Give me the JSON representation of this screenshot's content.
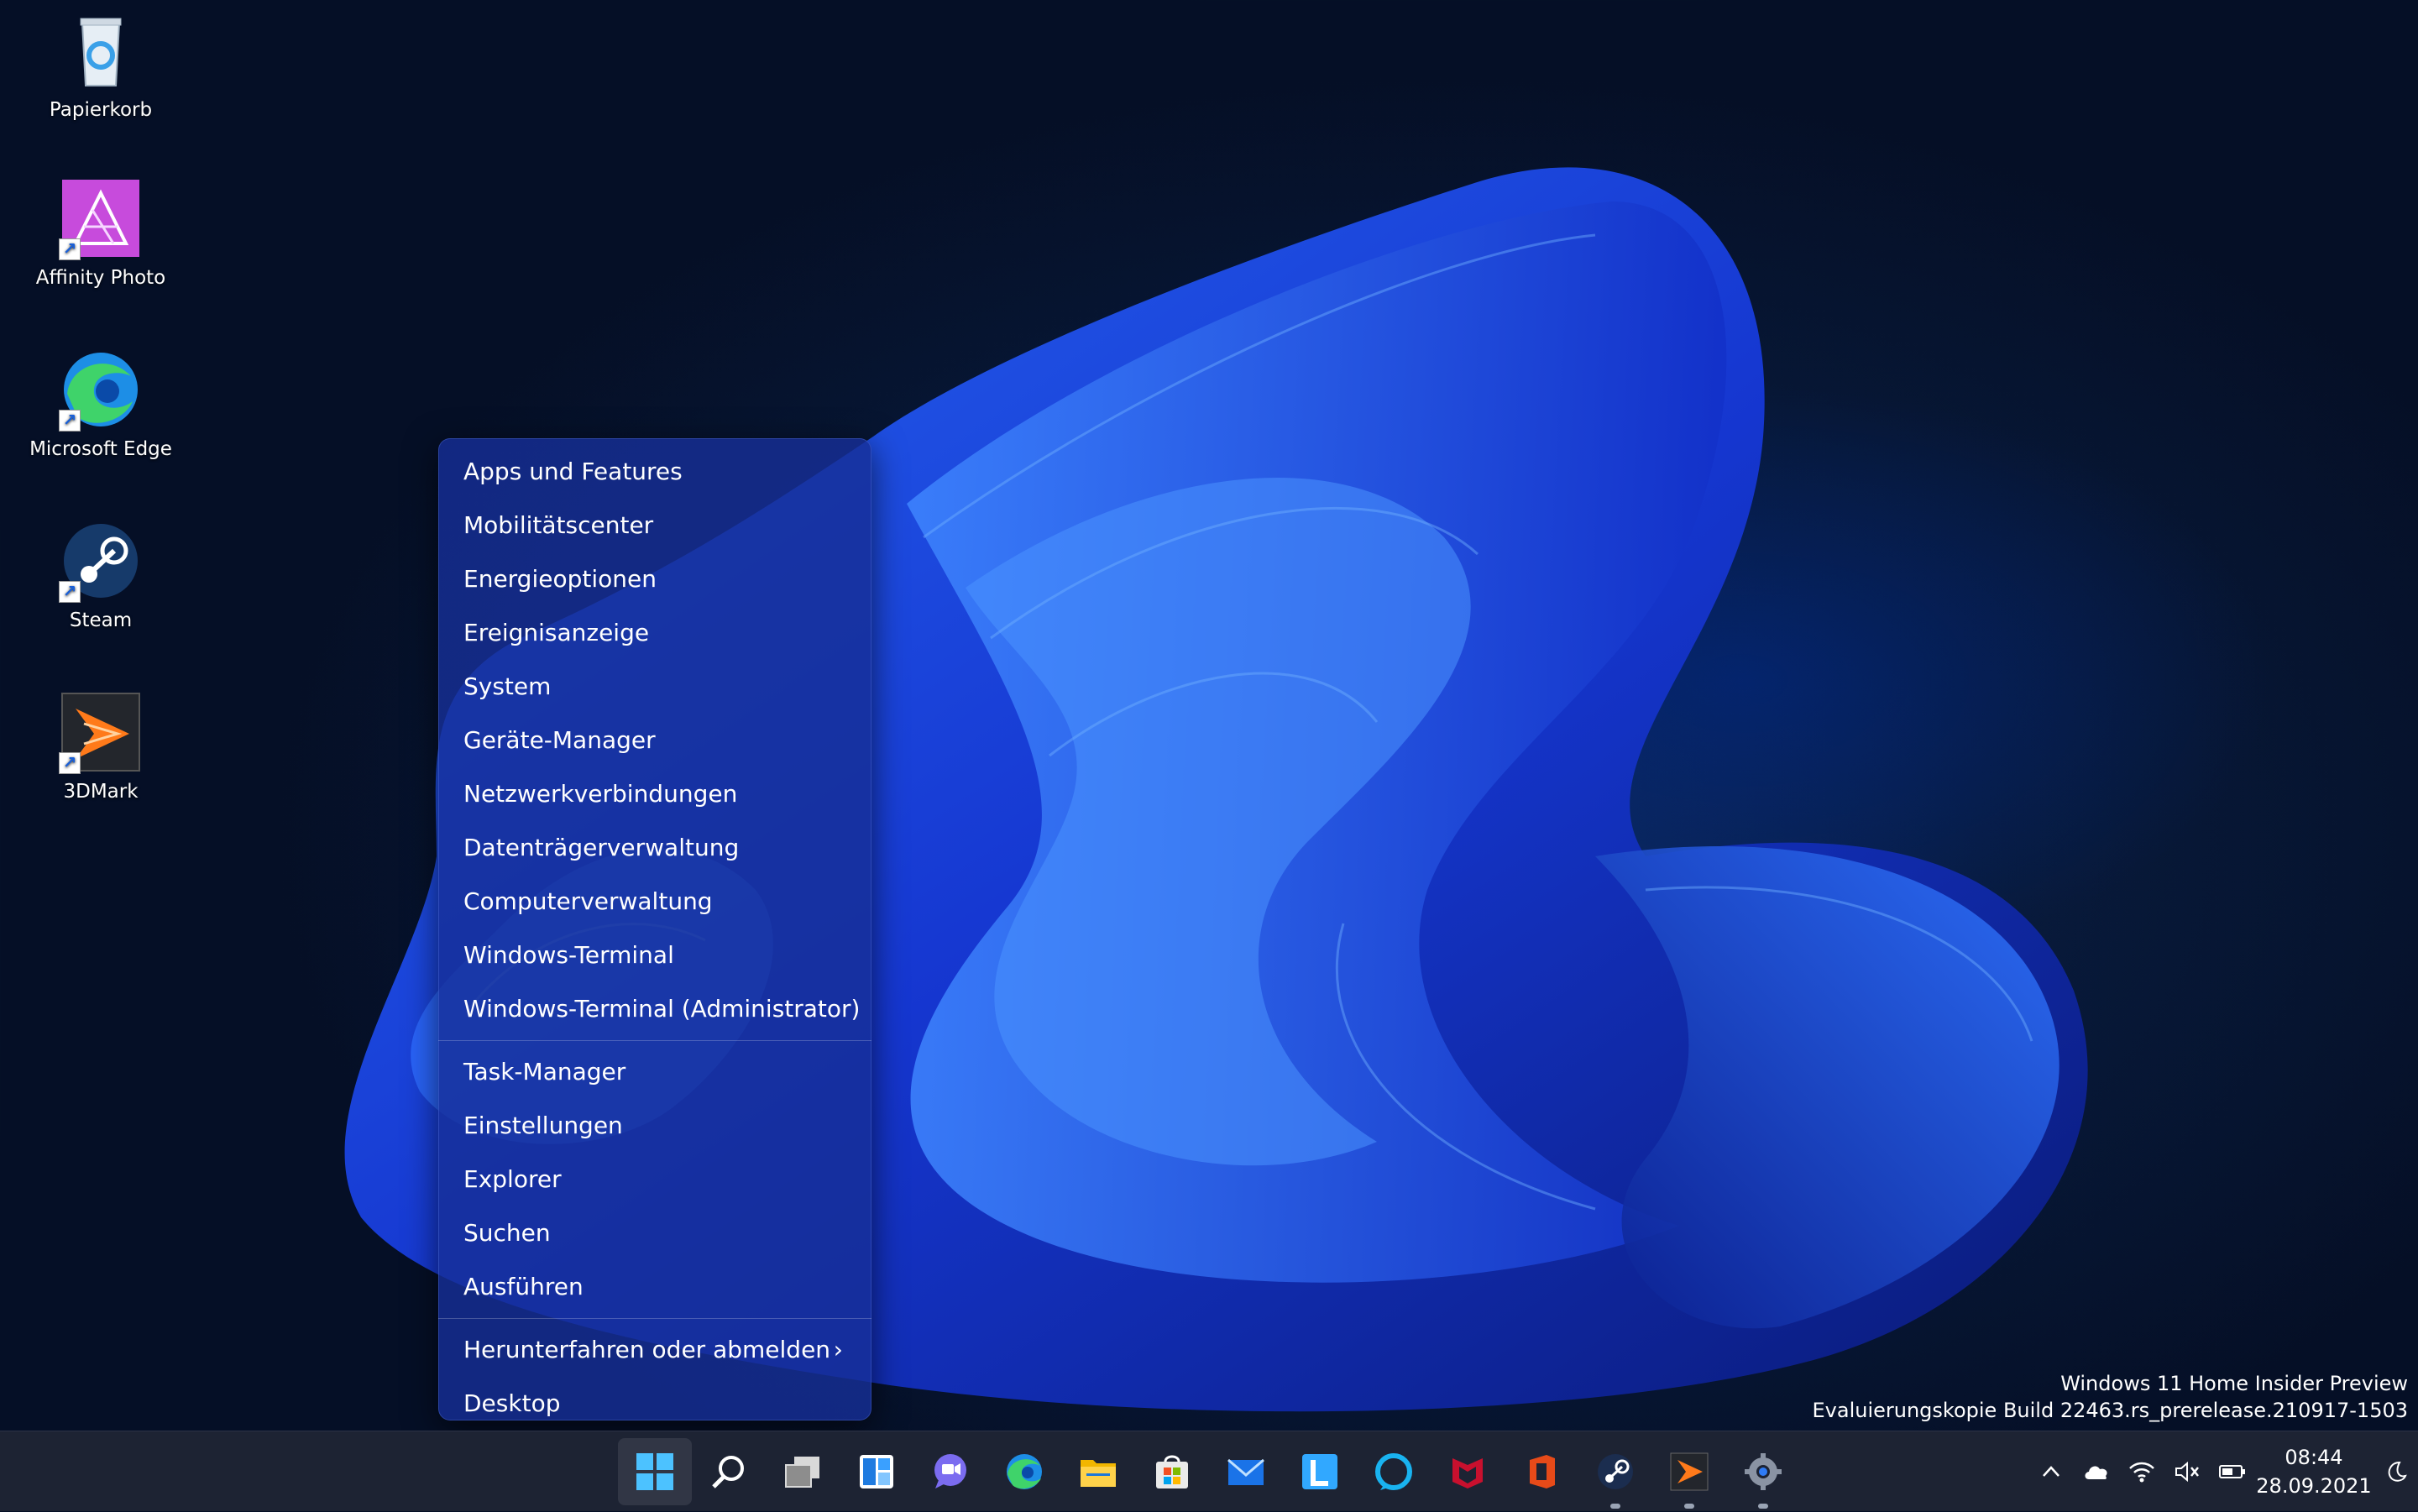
{
  "desktop": {
    "icons": [
      {
        "label": "Papierkorb",
        "icon": "recycle-bin-icon"
      },
      {
        "label": "Affinity Photo",
        "icon": "affinity-photo-icon"
      },
      {
        "label": "Microsoft Edge",
        "icon": "edge-icon"
      },
      {
        "label": "Steam",
        "icon": "steam-icon"
      },
      {
        "label": "3DMark",
        "icon": "3dmark-icon"
      }
    ]
  },
  "context_menu": {
    "group1": [
      "Apps und Features",
      "Mobilitätscenter",
      "Energieoptionen",
      "Ereignisanzeige",
      "System",
      "Geräte-Manager",
      "Netzwerkverbindungen",
      "Datenträgerverwaltung",
      "Computerverwaltung",
      "Windows-Terminal",
      "Windows-Terminal (Administrator)"
    ],
    "group2": [
      "Task-Manager",
      "Einstellungen",
      "Explorer",
      "Suchen",
      "Ausführen"
    ],
    "group3": [
      "Herunterfahren oder abmelden",
      "Desktop"
    ],
    "submenu_chevron": "›"
  },
  "watermark": {
    "line1": "Windows 11 Home Insider Preview",
    "line2": "Evaluierungskopie Build 22463.rs_prerelease.210917-1503"
  },
  "taskbar": {
    "pinned": [
      "start-icon",
      "search-icon",
      "task-view-icon",
      "widgets-icon",
      "chat-icon",
      "edge-icon",
      "file-explorer-icon",
      "store-icon",
      "mail-icon",
      "lightroom-icon",
      "alexa-icon",
      "mcafee-icon",
      "office-icon",
      "steam-icon",
      "3dmark-icon",
      "settings-icon"
    ],
    "tray": {
      "time": "08:44",
      "date": "28.09.2021"
    }
  },
  "colors": {
    "menu_bg": "#1a2e96",
    "taskbar_bg": "#1d2333",
    "accent": "#3b8bf5"
  }
}
